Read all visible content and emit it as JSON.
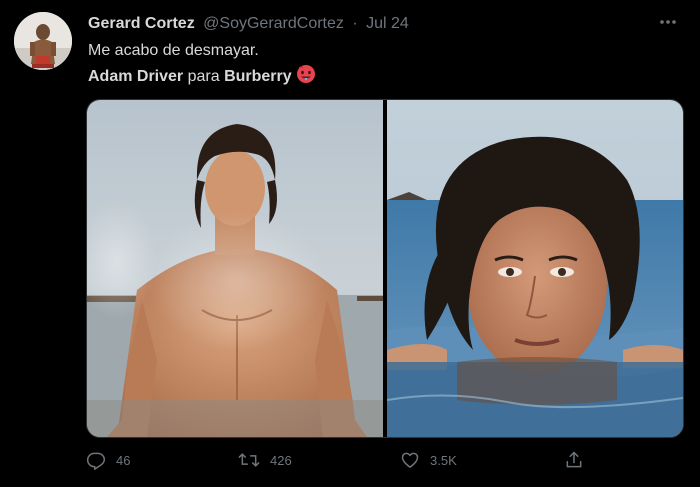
{
  "author": {
    "display_name": "Gerard Cortez",
    "handle": "@SoyGerardCortez",
    "separator": "·",
    "date": "Jul 24"
  },
  "tweet": {
    "line1": "Me acabo de desmayar.",
    "line2_bold1": "Adam Driver",
    "line2_mid": " para ",
    "line2_bold2": "Burberry",
    "emoji": "hot-face-emoji"
  },
  "media": {
    "count": 2
  },
  "actions": {
    "replies": "46",
    "retweets": "426",
    "likes": "3.5K"
  },
  "colors": {
    "background": "#000000",
    "text": "#d9d9d9",
    "muted": "#6e767d",
    "border": "#2f3336"
  }
}
